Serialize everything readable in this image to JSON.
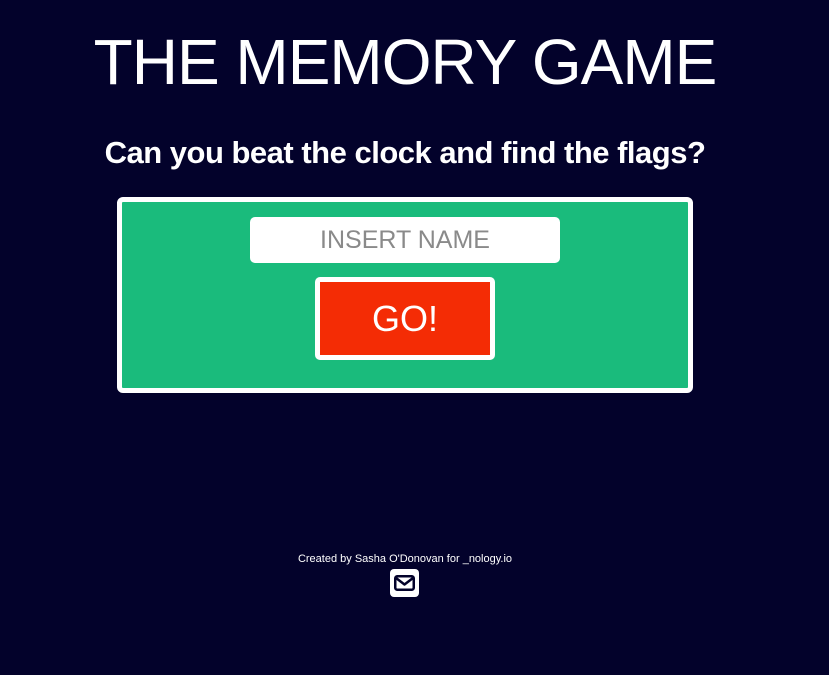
{
  "header": {
    "title": "THE MEMORY GAME",
    "subtitle": "Can you beat the clock and find the flags?"
  },
  "form": {
    "name_placeholder": "INSERT NAME",
    "go_label": "GO!"
  },
  "footer": {
    "credit": "Created by Sasha O'Donovan for _nology.io",
    "contact_icon": "envelope-icon"
  },
  "colors": {
    "background": "#03022b",
    "panel": "#1abb7c",
    "go_button": "#f42c05",
    "text": "#ffffff"
  }
}
